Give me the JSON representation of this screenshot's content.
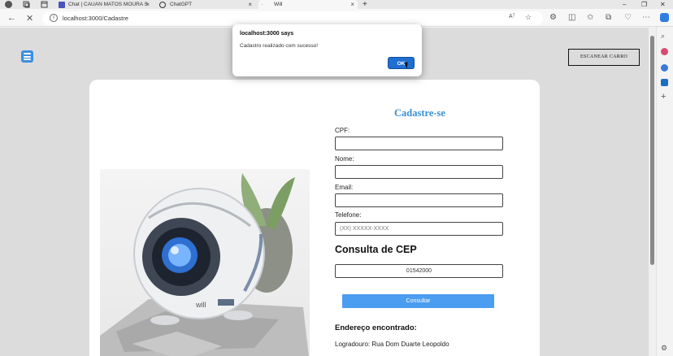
{
  "browser": {
    "tabs": [
      {
        "title": "Chat | CAUAN MATOS MOURA S",
        "close": "×"
      },
      {
        "title": "ChatGPT",
        "close": "×"
      },
      {
        "title": "Will",
        "close": "×"
      }
    ],
    "new_tab": "+",
    "window_controls": [
      "–",
      "❐",
      "✕"
    ],
    "url": "localhost:3000/Cadastre",
    "read_aloud": "Aᵀ"
  },
  "page": {
    "scan_button": "ESCANEAR CARRO",
    "form": {
      "title": "Cadastre-se",
      "cpf_label": "CPF:",
      "nome_label": "Nome:",
      "email_label": "Email:",
      "telefone_label": "Telefone:",
      "telefone_placeholder": "(XX) XXXXX-XXXX",
      "cep_title": "Consulta de CEP",
      "cep_value": "01542000",
      "consultar_label": "Consultar",
      "endereco_title": "Endereço encontrado:",
      "logradouro": "Logradouro: Rua Dom Duarte Leopoldo"
    }
  },
  "dialog": {
    "title": "localhost:3000 says",
    "message": "Cadastro realizado com sucesso!",
    "ok_label": "OK"
  },
  "colors": {
    "accent": "#3a8fd6",
    "button": "#4a9df0",
    "ok": "#1f6fd0",
    "page_bg": "#dcdcdc"
  }
}
